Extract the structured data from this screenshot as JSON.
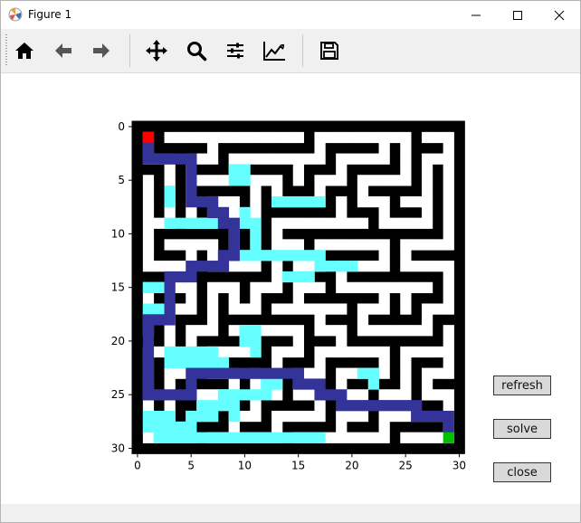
{
  "window": {
    "title": "Figure 1"
  },
  "toolbar": {
    "items": [
      {
        "icon": "home-icon"
      },
      {
        "icon": "arrow-left-icon"
      },
      {
        "icon": "arrow-right-icon"
      },
      {
        "icon": "move-icon"
      },
      {
        "icon": "zoom-icon"
      },
      {
        "icon": "configure-icon"
      },
      {
        "icon": "edit-axis-icon"
      },
      {
        "icon": "save-icon"
      }
    ]
  },
  "buttons": {
    "refresh": "refresh",
    "solve": "solve",
    "close": "close"
  },
  "colors": {
    "wall": "#000000",
    "path": "#ffffff",
    "explored": "#66ffff",
    "solution": "#333399",
    "start": "#ff0000",
    "end": "#00c000"
  },
  "chart_data": {
    "type": "heatmap",
    "title": "",
    "xlabel": "",
    "ylabel": "",
    "xlim": [
      0,
      30
    ],
    "ylim": [
      30,
      0
    ],
    "xticks": [
      0,
      5,
      10,
      15,
      20,
      25,
      30
    ],
    "yticks": [
      0,
      5,
      10,
      15,
      20,
      25,
      30
    ],
    "start": [
      1,
      1
    ],
    "end": [
      29,
      29
    ],
    "solution_path": [
      [
        1,
        2
      ],
      [
        1,
        3
      ],
      [
        2,
        3
      ],
      [
        3,
        3
      ],
      [
        4,
        3
      ],
      [
        5,
        3
      ],
      [
        5,
        4
      ],
      [
        5,
        5
      ],
      [
        5,
        6
      ],
      [
        5,
        7
      ],
      [
        6,
        7
      ],
      [
        7,
        7
      ],
      [
        7,
        8
      ],
      [
        8,
        8
      ],
      [
        8,
        9
      ],
      [
        9,
        9
      ],
      [
        9,
        10
      ],
      [
        9,
        11
      ],
      [
        9,
        12
      ],
      [
        8,
        12
      ],
      [
        8,
        13
      ],
      [
        7,
        13
      ],
      [
        6,
        13
      ],
      [
        5,
        13
      ],
      [
        5,
        14
      ],
      [
        4,
        14
      ],
      [
        3,
        14
      ],
      [
        3,
        15
      ],
      [
        3,
        16
      ],
      [
        3,
        17
      ],
      [
        3,
        18
      ],
      [
        2,
        18
      ],
      [
        1,
        18
      ],
      [
        1,
        19
      ],
      [
        1,
        20
      ],
      [
        1,
        21
      ],
      [
        1,
        22
      ],
      [
        1,
        23
      ],
      [
        1,
        24
      ],
      [
        1,
        25
      ],
      [
        2,
        25
      ],
      [
        3,
        25
      ],
      [
        4,
        25
      ],
      [
        5,
        25
      ],
      [
        5,
        24
      ],
      [
        5,
        23
      ],
      [
        6,
        23
      ],
      [
        7,
        23
      ],
      [
        8,
        23
      ],
      [
        9,
        23
      ],
      [
        10,
        23
      ],
      [
        11,
        23
      ],
      [
        12,
        23
      ],
      [
        13,
        23
      ],
      [
        14,
        23
      ],
      [
        15,
        23
      ],
      [
        15,
        24
      ],
      [
        16,
        24
      ],
      [
        17,
        24
      ],
      [
        17,
        25
      ],
      [
        18,
        25
      ],
      [
        19,
        25
      ],
      [
        19,
        26
      ],
      [
        20,
        26
      ],
      [
        21,
        26
      ],
      [
        22,
        26
      ],
      [
        23,
        26
      ],
      [
        24,
        26
      ],
      [
        25,
        26
      ],
      [
        26,
        26
      ],
      [
        26,
        27
      ],
      [
        27,
        27
      ],
      [
        28,
        27
      ],
      [
        29,
        27
      ],
      [
        29,
        28
      ]
    ],
    "explored_cells": [
      [
        1,
        15
      ],
      [
        2,
        15
      ],
      [
        1,
        17
      ],
      [
        2,
        17
      ],
      [
        1,
        27
      ],
      [
        1,
        28
      ],
      [
        2,
        27
      ],
      [
        2,
        28
      ],
      [
        3,
        28
      ],
      [
        3,
        27
      ],
      [
        4,
        28
      ],
      [
        5,
        27
      ],
      [
        5,
        28
      ],
      [
        6,
        26
      ],
      [
        6,
        27
      ],
      [
        7,
        26
      ],
      [
        7,
        27
      ],
      [
        8,
        26
      ],
      [
        8,
        25
      ],
      [
        9,
        25
      ],
      [
        9,
        26
      ],
      [
        9,
        27
      ],
      [
        10,
        25
      ],
      [
        11,
        25
      ],
      [
        12,
        24
      ],
      [
        12,
        25
      ],
      [
        13,
        24
      ],
      [
        3,
        21
      ],
      [
        3,
        22
      ],
      [
        4,
        21
      ],
      [
        4,
        22
      ],
      [
        5,
        21
      ],
      [
        5,
        22
      ],
      [
        6,
        21
      ],
      [
        6,
        22
      ],
      [
        7,
        21
      ],
      [
        7,
        22
      ],
      [
        8,
        22
      ],
      [
        10,
        20
      ],
      [
        10,
        19
      ],
      [
        11,
        20
      ],
      [
        11,
        19
      ],
      [
        11,
        21
      ],
      [
        3,
        6
      ],
      [
        3,
        7
      ],
      [
        3,
        9
      ],
      [
        4,
        9
      ],
      [
        5,
        9
      ],
      [
        6,
        9
      ],
      [
        7,
        8
      ],
      [
        7,
        9
      ],
      [
        9,
        4
      ],
      [
        9,
        5
      ],
      [
        10,
        4
      ],
      [
        10,
        5
      ],
      [
        10,
        12
      ],
      [
        11,
        12
      ],
      [
        12,
        12
      ],
      [
        13,
        12
      ],
      [
        14,
        12
      ],
      [
        15,
        12
      ],
      [
        14,
        14
      ],
      [
        15,
        14
      ],
      [
        16,
        14
      ],
      [
        17,
        13
      ],
      [
        17,
        12
      ],
      [
        16,
        12
      ],
      [
        18,
        13
      ],
      [
        19,
        13
      ],
      [
        20,
        13
      ],
      [
        10,
        8
      ],
      [
        10,
        9
      ],
      [
        11,
        9
      ],
      [
        11,
        10
      ],
      [
        11,
        11
      ],
      [
        16,
        7
      ],
      [
        17,
        7
      ],
      [
        15,
        7
      ],
      [
        14,
        7
      ],
      [
        13,
        7
      ],
      [
        22,
        23
      ],
      [
        21,
        23
      ],
      [
        22,
        24
      ],
      [
        17,
        29
      ],
      [
        16,
        29
      ],
      [
        15,
        29
      ],
      [
        14,
        29
      ],
      [
        13,
        29
      ],
      [
        12,
        29
      ],
      [
        11,
        29
      ],
      [
        10,
        29
      ],
      [
        9,
        29
      ],
      [
        8,
        29
      ],
      [
        7,
        29
      ],
      [
        6,
        29
      ],
      [
        5,
        29
      ],
      [
        4,
        29
      ],
      [
        3,
        29
      ],
      [
        2,
        29
      ]
    ]
  }
}
